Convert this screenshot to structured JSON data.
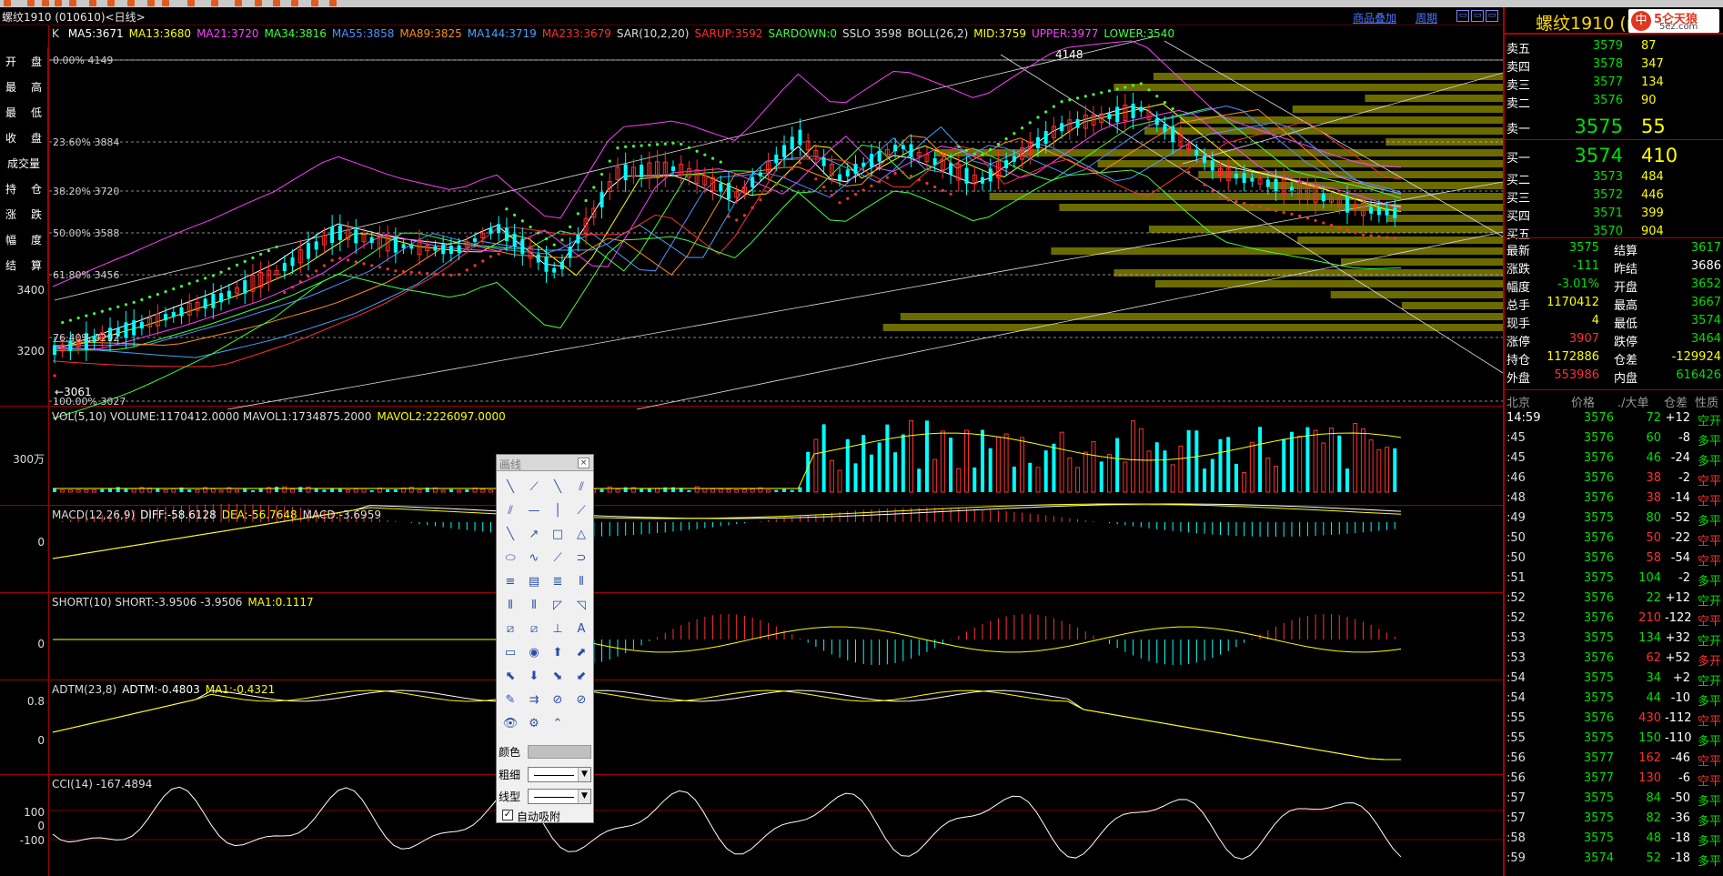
{
  "window": {
    "title": "螺纹1910 (010610)<日线>",
    "link_overlay": "商品叠加",
    "link_period": "周期"
  },
  "left_nav": [
    {
      "a": "开",
      "b": "盘"
    },
    {
      "a": "最",
      "b": "高"
    },
    {
      "a": "最",
      "b": "低"
    },
    {
      "a": "收",
      "b": "盘"
    },
    {
      "full": "成交量"
    },
    {
      "a": "持",
      "b": "仓"
    },
    {
      "a": "涨",
      "b": "跌"
    },
    {
      "a": "幅",
      "b": "度"
    },
    {
      "a": "结",
      "b": "算"
    }
  ],
  "main_indicator": {
    "k": "K",
    "items": [
      {
        "text": "MA5:3671",
        "color": "#ffffff"
      },
      {
        "text": "MA13:3680",
        "color": "#ffff00"
      },
      {
        "text": "MA21:3720",
        "color": "#ff40ff"
      },
      {
        "text": "MA34:3816",
        "color": "#40ff40"
      },
      {
        "text": "MA55:3858",
        "color": "#5090ff"
      },
      {
        "text": "MA89:3825",
        "color": "#ff8c1a"
      },
      {
        "text": "MA144:3719",
        "color": "#4aa0ff"
      },
      {
        "text": "MA233:3679",
        "color": "#ff3030"
      },
      {
        "text": "SAR(10,2,20)",
        "color": "#dddddd"
      },
      {
        "text": "SARUP:3592",
        "color": "#ff3030"
      },
      {
        "text": "SARDOWN:0",
        "color": "#40ff40"
      },
      {
        "text": "SSLO 3598",
        "color": "#dddddd"
      },
      {
        "text": "BOLL(26,2)",
        "color": "#dddddd"
      },
      {
        "text": "MID:3759",
        "color": "#ffff00"
      },
      {
        "text": "UPPER:3977",
        "color": "#ff40ff"
      },
      {
        "text": "LOWER:3540",
        "color": "#40ff40"
      }
    ]
  },
  "fib": [
    {
      "label": "0.00% 4149"
    },
    {
      "label": "23.60% 3884"
    },
    {
      "label": "38.20% 3720"
    },
    {
      "label": "50.00% 3588"
    },
    {
      "label": "61.80% 3456"
    },
    {
      "label": "76.40% 3292"
    },
    {
      "label": "100.00% 3027"
    }
  ],
  "price_axis": [
    "3400",
    "3200"
  ],
  "price_marks": {
    "high": "4148",
    "low": "3061"
  },
  "vol": {
    "title": "VOL(5,10) VOLUME:1170412.0000 MAVOL1:1734875.2000",
    "title2": "MAVOL2:2226097.0000",
    "axis": "300万"
  },
  "macd": {
    "title": "MACD(12,26,9)",
    "diff": "DIFF:-58.6128",
    "dea": "DEA:-56.7648",
    "macd": "MACD:-3.6959",
    "axis": "0"
  },
  "short": {
    "title": "SHORT(10) SHORT:-3.9506 -3.9506",
    "ma": "MA1:0.1117",
    "axis": "0"
  },
  "adtm": {
    "title": "ADTM(23,8)",
    "val": "ADTM:-0.4803",
    "ma": "MA1:-0.4321",
    "axis_top": "0.8",
    "axis_mid": "0"
  },
  "cci": {
    "title": "CCI(14) -167.4894",
    "axis": [
      "100",
      "0",
      "-100"
    ]
  },
  "draw_dialog": {
    "title": "画线",
    "close": "×",
    "color_label": "颜色",
    "width_label": "粗细",
    "style_label": "线型",
    "auto_snap": "自动吸附",
    "checked": "✓",
    "tools": [
      "╲",
      "⟋",
      "╲",
      "⫽",
      "⫽",
      "—",
      "│",
      "⟋",
      "╲",
      "↗",
      "□",
      "△",
      "⬭",
      "∿",
      "⟋",
      "⊃",
      "≡",
      "▤",
      "≣",
      "⦀",
      "⦀",
      "⦀",
      "◸",
      "◹",
      "⧄",
      "⧄",
      "⊥",
      "A",
      "▭",
      "◉",
      "⬆",
      "⬈",
      "⬉",
      "⬇",
      "⬊",
      "⬋",
      "✎",
      "⇉",
      "⊘",
      "⊘",
      "👁",
      "⚙",
      "⌃"
    ]
  },
  "quote": {
    "name": "螺纹1910 (r",
    "logo_char": "中",
    "logo_text": "5仑天狼",
    "logo_sub": "5ez.com",
    "asks": [
      {
        "l": "卖五",
        "p": "3579",
        "v": "87"
      },
      {
        "l": "卖四",
        "p": "3578",
        "v": "347"
      },
      {
        "l": "卖三",
        "p": "3577",
        "v": "134"
      },
      {
        "l": "卖二",
        "p": "3576",
        "v": "90"
      },
      {
        "l": "卖一",
        "p": "3575",
        "v": "55"
      }
    ],
    "bids": [
      {
        "l": "买一",
        "p": "3574",
        "v": "410"
      },
      {
        "l": "买二",
        "p": "3573",
        "v": "484"
      },
      {
        "l": "买三",
        "p": "3572",
        "v": "446"
      },
      {
        "l": "买四",
        "p": "3571",
        "v": "399"
      },
      {
        "l": "买五",
        "p": "3570",
        "v": "904"
      }
    ],
    "stats": [
      {
        "a": "最新",
        "b": "3575",
        "bc": "grn",
        "c": "结算",
        "d": "3617",
        "dc": "grn"
      },
      {
        "a": "涨跌",
        "b": "-111",
        "bc": "grn",
        "c": "昨结",
        "d": "3686",
        "dc": "wht"
      },
      {
        "a": "幅度",
        "b": "-3.01%",
        "bc": "grn",
        "c": "开盘",
        "d": "3652",
        "dc": "grn"
      },
      {
        "a": "总手",
        "b": "1170412",
        "bc": "yel",
        "c": "最高",
        "d": "3667",
        "dc": "grn"
      },
      {
        "a": "现手",
        "b": "4",
        "bc": "yel",
        "c": "最低",
        "d": "3574",
        "dc": "grn"
      },
      {
        "a": "涨停",
        "b": "3907",
        "bc": "red",
        "c": "跌停",
        "d": "3464",
        "dc": "grn"
      },
      {
        "a": "持仓",
        "b": "1172886",
        "bc": "yel",
        "c": "仓差",
        "d": "-129924",
        "dc": "yel"
      },
      {
        "a": "外盘",
        "b": "553986",
        "bc": "red",
        "c": "内盘",
        "d": "616426",
        "dc": "grn"
      }
    ],
    "tick_header": {
      "t": "北京",
      "p": "价格",
      "v": "./大单",
      "c": "仓差",
      "n": "性质"
    },
    "ticks": [
      {
        "t": "14:59",
        "p": "3576",
        "v": "72",
        "vc": "grn",
        "c": "+12",
        "cc": "wht",
        "n": "空开",
        "nc": "grn"
      },
      {
        "t": ":45",
        "p": "3576",
        "v": "60",
        "vc": "grn",
        "c": "-8",
        "cc": "wht",
        "n": "多平",
        "nc": "grn"
      },
      {
        "t": ":45",
        "p": "3576",
        "v": "46",
        "vc": "grn",
        "c": "-24",
        "cc": "wht",
        "n": "多平",
        "nc": "grn"
      },
      {
        "t": ":46",
        "p": "3576",
        "v": "38",
        "vc": "red",
        "c": "-2",
        "cc": "wht",
        "n": "空平",
        "nc": "red"
      },
      {
        "t": ":48",
        "p": "3576",
        "v": "38",
        "vc": "red",
        "c": "-14",
        "cc": "wht",
        "n": "空平",
        "nc": "red"
      },
      {
        "t": ":49",
        "p": "3575",
        "v": "80",
        "vc": "grn",
        "c": "-52",
        "cc": "wht",
        "n": "多平",
        "nc": "grn"
      },
      {
        "t": ":50",
        "p": "3576",
        "v": "50",
        "vc": "red",
        "c": "-22",
        "cc": "wht",
        "n": "空平",
        "nc": "red"
      },
      {
        "t": ":50",
        "p": "3576",
        "v": "58",
        "vc": "red",
        "c": "-54",
        "cc": "wht",
        "n": "空平",
        "nc": "red"
      },
      {
        "t": ":51",
        "p": "3575",
        "v": "104",
        "vc": "grn",
        "c": "-2",
        "cc": "wht",
        "n": "多平",
        "nc": "grn"
      },
      {
        "t": ":52",
        "p": "3576",
        "v": "22",
        "vc": "grn",
        "c": "+12",
        "cc": "wht",
        "n": "空开",
        "nc": "grn"
      },
      {
        "t": ":52",
        "p": "3576",
        "v": "210",
        "vc": "red",
        "c": "-122",
        "cc": "wht",
        "n": "空平",
        "nc": "red"
      },
      {
        "t": ":53",
        "p": "3575",
        "v": "134",
        "vc": "grn",
        "c": "+32",
        "cc": "wht",
        "n": "空开",
        "nc": "grn"
      },
      {
        "t": ":53",
        "p": "3576",
        "v": "62",
        "vc": "red",
        "c": "+52",
        "cc": "wht",
        "n": "多开",
        "nc": "red"
      },
      {
        "t": ":54",
        "p": "3575",
        "v": "34",
        "vc": "grn",
        "c": "+2",
        "cc": "wht",
        "n": "空开",
        "nc": "grn"
      },
      {
        "t": ":54",
        "p": "3575",
        "v": "44",
        "vc": "grn",
        "c": "-10",
        "cc": "wht",
        "n": "多平",
        "nc": "grn"
      },
      {
        "t": ":55",
        "p": "3576",
        "v": "430",
        "vc": "red",
        "c": "-112",
        "cc": "wht",
        "n": "空平",
        "nc": "red"
      },
      {
        "t": ":55",
        "p": "3575",
        "v": "150",
        "vc": "grn",
        "c": "-110",
        "cc": "wht",
        "n": "多平",
        "nc": "grn"
      },
      {
        "t": ":56",
        "p": "3577",
        "v": "162",
        "vc": "red",
        "c": "-46",
        "cc": "wht",
        "n": "空平",
        "nc": "red"
      },
      {
        "t": ":56",
        "p": "3577",
        "v": "130",
        "vc": "red",
        "c": "-6",
        "cc": "wht",
        "n": "空平",
        "nc": "red"
      },
      {
        "t": ":57",
        "p": "3575",
        "v": "84",
        "vc": "grn",
        "c": "-50",
        "cc": "wht",
        "n": "多平",
        "nc": "grn"
      },
      {
        "t": ":57",
        "p": "3575",
        "v": "82",
        "vc": "grn",
        "c": "-36",
        "cc": "wht",
        "n": "多平",
        "nc": "grn"
      },
      {
        "t": ":58",
        "p": "3575",
        "v": "48",
        "vc": "grn",
        "c": "-18",
        "cc": "wht",
        "n": "多平",
        "nc": "grn"
      },
      {
        "t": ":59",
        "p": "3574",
        "v": "52",
        "vc": "grn",
        "c": "-18",
        "cc": "wht",
        "n": "多平",
        "nc": "grn"
      }
    ]
  }
}
